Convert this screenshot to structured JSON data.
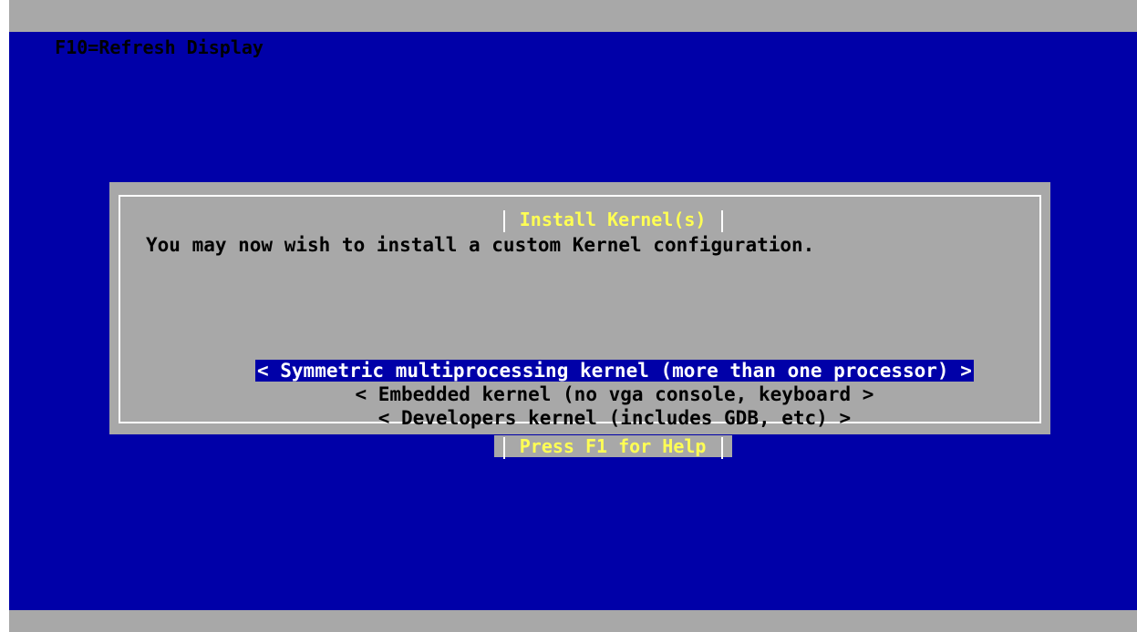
{
  "topbar": {
    "label": "F10=Refresh Display"
  },
  "dialog": {
    "title": "Install Kernel(s)",
    "message": "You may now wish to install a custom Kernel configuration.",
    "options": [
      {
        "label": "< Symmetric multiprocessing kernel (more than one processor) >",
        "selected": true
      },
      {
        "label": "< Embedded kernel (no vga console, keyboard >",
        "selected": false
      },
      {
        "label": "< Developers kernel (includes GDB, etc) >",
        "selected": false
      }
    ],
    "footer": "Press F1 for Help"
  },
  "colors": {
    "screen_background": "#0000a8",
    "dialog_background": "#a8a8a8",
    "title_text": "#ffff54",
    "selected_background": "#0000a8",
    "selected_text": "#ffffff"
  }
}
